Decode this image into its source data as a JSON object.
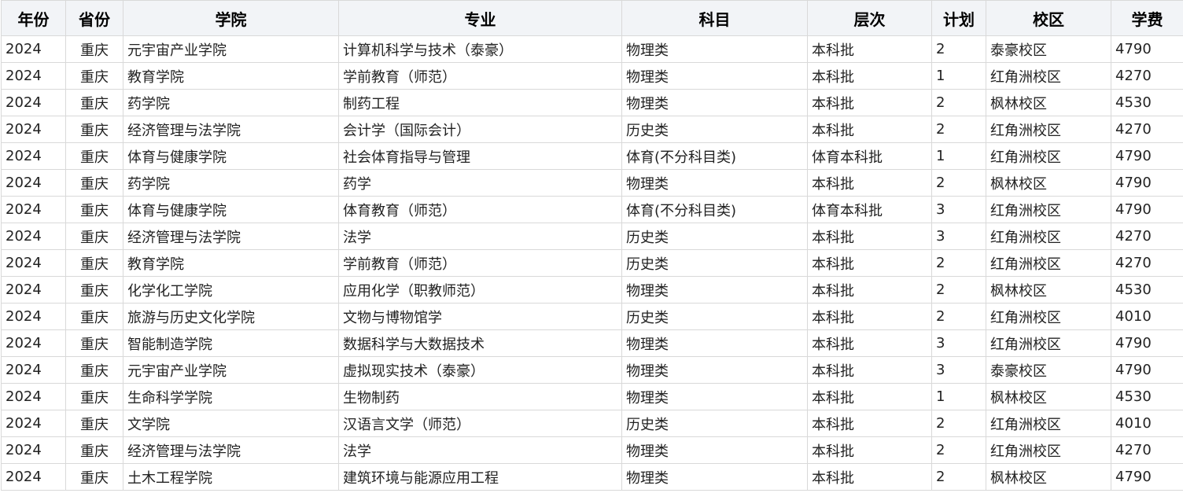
{
  "table": {
    "headers": [
      "年份",
      "省份",
      "学院",
      "专业",
      "科目",
      "层次",
      "计划",
      "校区",
      "学费"
    ],
    "rows": [
      [
        "2024",
        "重庆",
        "元宇宙产业学院",
        "计算机科学与技术（泰豪）",
        "物理类",
        "本科批",
        "2",
        "泰豪校区",
        "4790"
      ],
      [
        "2024",
        "重庆",
        "教育学院",
        "学前教育（师范）",
        "物理类",
        "本科批",
        "1",
        "红角洲校区",
        "4270"
      ],
      [
        "2024",
        "重庆",
        "药学院",
        "制药工程",
        "物理类",
        "本科批",
        "2",
        "枫林校区",
        "4530"
      ],
      [
        "2024",
        "重庆",
        "经济管理与法学院",
        "会计学（国际会计）",
        "历史类",
        "本科批",
        "2",
        "红角洲校区",
        "4270"
      ],
      [
        "2024",
        "重庆",
        "体育与健康学院",
        "社会体育指导与管理",
        "体育(不分科目类)",
        "体育本科批",
        "1",
        "红角洲校区",
        "4790"
      ],
      [
        "2024",
        "重庆",
        "药学院",
        "药学",
        "物理类",
        "本科批",
        "2",
        "枫林校区",
        "4790"
      ],
      [
        "2024",
        "重庆",
        "体育与健康学院",
        "体育教育（师范）",
        "体育(不分科目类)",
        "体育本科批",
        "3",
        "红角洲校区",
        "4790"
      ],
      [
        "2024",
        "重庆",
        "经济管理与法学院",
        "法学",
        "历史类",
        "本科批",
        "3",
        "红角洲校区",
        "4270"
      ],
      [
        "2024",
        "重庆",
        "教育学院",
        "学前教育（师范）",
        "历史类",
        "本科批",
        "2",
        "红角洲校区",
        "4270"
      ],
      [
        "2024",
        "重庆",
        "化学化工学院",
        "应用化学（职教师范）",
        "物理类",
        "本科批",
        "2",
        "枫林校区",
        "4530"
      ],
      [
        "2024",
        "重庆",
        "旅游与历史文化学院",
        "文物与博物馆学",
        "历史类",
        "本科批",
        "2",
        "红角洲校区",
        "4010"
      ],
      [
        "2024",
        "重庆",
        "智能制造学院",
        "数据科学与大数据技术",
        "物理类",
        "本科批",
        "3",
        "红角洲校区",
        "4790"
      ],
      [
        "2024",
        "重庆",
        "元宇宙产业学院",
        "虚拟现实技术（泰豪）",
        "物理类",
        "本科批",
        "3",
        "泰豪校区",
        "4790"
      ],
      [
        "2024",
        "重庆",
        "生命科学学院",
        "生物制药",
        "物理类",
        "本科批",
        "1",
        "枫林校区",
        "4530"
      ],
      [
        "2024",
        "重庆",
        "文学院",
        "汉语言文学（师范）",
        "历史类",
        "本科批",
        "2",
        "红角洲校区",
        "4010"
      ],
      [
        "2024",
        "重庆",
        "经济管理与法学院",
        "法学",
        "物理类",
        "本科批",
        "2",
        "红角洲校区",
        "4270"
      ],
      [
        "2024",
        "重庆",
        "土木工程学院",
        "建筑环境与能源应用工程",
        "物理类",
        "本科批",
        "2",
        "枫林校区",
        "4790"
      ]
    ]
  }
}
